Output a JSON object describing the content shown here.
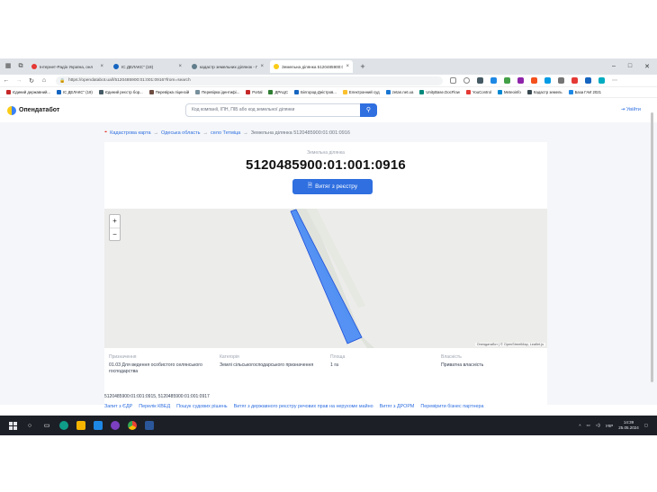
{
  "browser": {
    "tabs": [
      {
        "title": "Інтернет-Радіо Україна, онл",
        "color": "#e53935",
        "active": false
      },
      {
        "title": "ІС ДЕЛАКС\" (19)",
        "color": "#1565c0",
        "active": false
      },
      {
        "title": "кадастр земельних ділянок - По",
        "color": "#607d8b",
        "active": false
      },
      {
        "title": "Земельна ділянка 5120485900:01:0",
        "color": "#facc15",
        "active": true
      }
    ],
    "url": "https://opendatabot.ua/l/5120485900:01:001:0916?from=search",
    "new_tab": "+",
    "favorites": [
      {
        "label": "Єдиний державний...",
        "color": "#c62828"
      },
      {
        "label": "ІС ДЕЛАКС\" (19)",
        "color": "#1565c0"
      },
      {
        "label": "Єдиний реєстр бор...",
        "color": "#455a64"
      },
      {
        "label": "Перевірка ліцензій",
        "color": "#6d4c41"
      },
      {
        "label": "Перевірка ідентифі...",
        "color": "#78909c"
      },
      {
        "label": "Portal",
        "color": "#c62828"
      },
      {
        "label": "ДРАЦС",
        "color": "#2e7d32"
      },
      {
        "label": "Білгород-Дністров...",
        "color": "#1565c0"
      },
      {
        "label": "Електронний суд",
        "color": "#fbc02d"
      },
      {
        "label": "zetan.net.ua",
        "color": "#1976d2"
      },
      {
        "label": "UnityBase.DocFlow",
        "color": "#00897b"
      },
      {
        "label": "YouControl",
        "color": "#e53935"
      },
      {
        "label": "Meteoinfo",
        "color": "#0288d1"
      },
      {
        "label": "Кадастр земель",
        "color": "#37474f"
      },
      {
        "label": "База ГАИ 2021",
        "color": "#1e88e5"
      }
    ]
  },
  "site": {
    "logo": "Опендатабот",
    "search_placeholder": "Код компанії, ІПН, ПІБ або код земельної ділянки",
    "login": "Увійти"
  },
  "breadcrumb": {
    "items": [
      "Кадастрова карта",
      "Одеська область",
      "село Тетміца"
    ],
    "current": "Земельна ділянка 5120485900:01:001:0916",
    "separator": "→"
  },
  "parcel": {
    "subtitle": "Земельна ділянка",
    "cadastral_number": "5120485900:01:001:0916",
    "extract_button": "Витяг з реєстру"
  },
  "map": {
    "zoom_in": "+",
    "zoom_out": "−",
    "attribution": "Опендатабот | © OpenStreetMap, Leaflet.js",
    "parcel_color": "#3b82f6"
  },
  "info": [
    {
      "label": "Призначення",
      "value": "01.03 Для ведення особистого селянського господарства"
    },
    {
      "label": "Категорія",
      "value": "Землі сільськогосподарського призначення"
    },
    {
      "label": "Площа",
      "value": "1 га"
    },
    {
      "label": "Власність",
      "value": "Приватна власність"
    }
  ],
  "neighbors": "5120485900:01:001:0915, 5120485900:01:001:0917",
  "footer_links": [
    "Запит з ЄДР",
    "Перелік КВЕД",
    "Пошук судових рішень",
    "Витяг з державного реєстру речових прав на нерухоме майно",
    "Витяг з ДРОРМ",
    "Перевірити бізнес партнера"
  ],
  "taskbar": {
    "lang": "УКР",
    "time": "14:39",
    "date": "25.05.2024"
  }
}
